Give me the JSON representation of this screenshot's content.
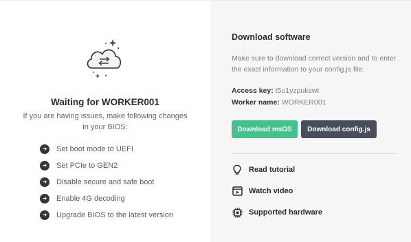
{
  "left": {
    "title": "Waiting for WORKER001",
    "subtitle": "If you are having issues, make following changes in your BIOS:",
    "steps": [
      {
        "label": "Set boot mode to UEFI",
        "icon": "arrow-right-circle-icon"
      },
      {
        "label": "Set PCIe to GEN2",
        "icon": "arrow-right-circle-icon"
      },
      {
        "label": "Disable secure and safe boot",
        "icon": "arrow-right-circle-icon"
      },
      {
        "label": "Enable 4G decoding",
        "icon": "arrow-right-circle-icon"
      },
      {
        "label": "Upgrade BIOS to the latest version",
        "icon": "arrow-right-circle-icon"
      }
    ]
  },
  "right": {
    "title": "Download software",
    "description": "Make sure to download correct version and to enter the exact information to your config.js file.",
    "access_key_label": "Access key:",
    "access_key_value": "t5u1yzpukswt",
    "worker_name_label": "Worker name:",
    "worker_name_value": "WORKER001",
    "download_msos_label": "Download msOS",
    "download_config_label": "Download config.js",
    "links": [
      {
        "label": "Read tutorial",
        "icon": "lightbulb-icon"
      },
      {
        "label": "Watch video",
        "icon": "video-icon"
      },
      {
        "label": "Supported hardware",
        "icon": "chip-icon"
      }
    ]
  },
  "colors": {
    "accent_green": "#46c08c",
    "button_dark": "#474d5b",
    "panel_bg": "#f6f6f7"
  }
}
